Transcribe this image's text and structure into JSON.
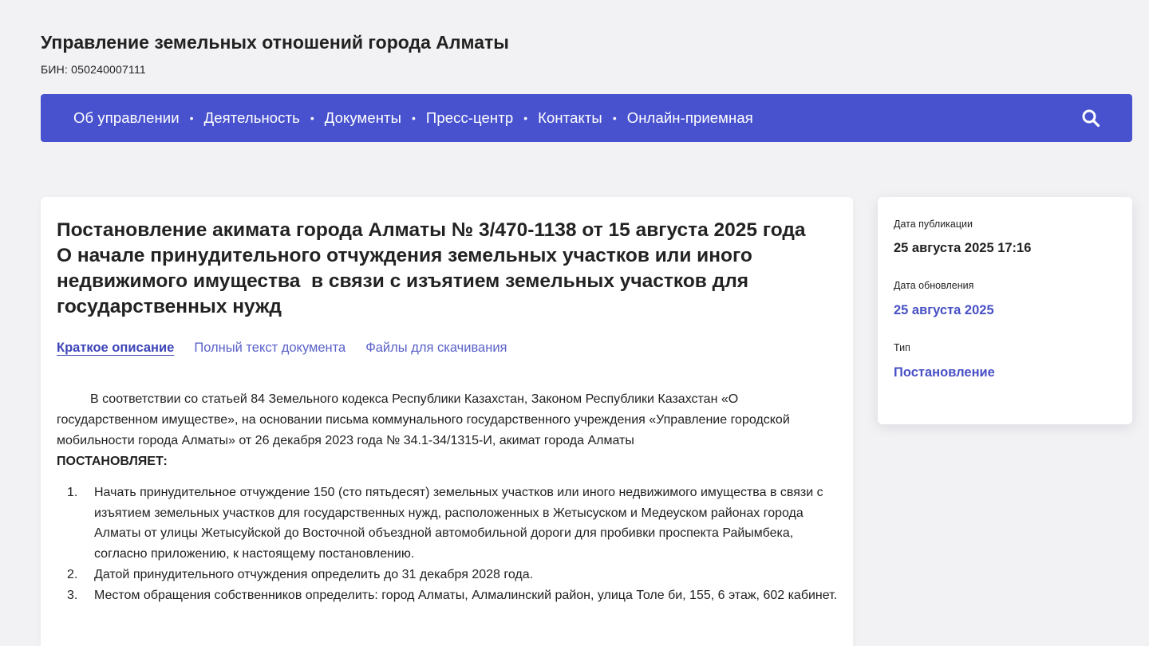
{
  "header": {
    "org_name": "Управление земельных отношений города Алматы",
    "bin": "БИН: 050240007111"
  },
  "nav": {
    "items": [
      {
        "label": "Об управлении"
      },
      {
        "label": "Деятельность"
      },
      {
        "label": "Документы"
      },
      {
        "label": "Пресс-центр"
      },
      {
        "label": "Контакты"
      },
      {
        "label": "Онлайн-приемная"
      }
    ],
    "separator": "•",
    "search_icon": "search-icon"
  },
  "document": {
    "title": "Постановление акимата города Алматы № 3/470-1138 от 15 августа 2025 года   О начале принудительного отчуждения земельных участков или иного недвижимого имущества  в связи с изъятием земельных участков для государственных нужд",
    "tabs": [
      {
        "label": "Краткое описание",
        "active": true
      },
      {
        "label": "Полный текст документа",
        "active": false
      },
      {
        "label": "Файлы для скачивания",
        "active": false
      }
    ],
    "intro": "В соответствии со статьей 84 Земельного кодекса Республики Казахстан, Законом Республики Казахстан «О государственном имуществе», на основании письма коммунального государственного учреждения «Управление городской мобильности города Алматы» от 26 декабря 2023 года № 34.1-34/1315-И, акимат города Алматы",
    "resolves": "ПОСТАНОВЛЯЕТ:",
    "points": [
      {
        "num": "1.",
        "text": "Начать принудительное отчуждение 150 (сто пятьдесят) земельных участков или иного недвижимого имущества в связи с изъятием земельных участков для государственных нужд, расположенных в Жетысуском и Медеуском районах города Алматы от улицы Жетысуйской до Восточной объездной автомобильной дороги для пробивки проспекта Райымбека, согласно приложению, к настоящему постановлению."
      },
      {
        "num": "2.",
        "text": "Датой принудительного отчуждения определить до 31 декабря 2028 года."
      },
      {
        "num": "3.",
        "text": "Местом обращения собственников определить: город Алматы, Алмалинский район, улица Толе би, 155, 6 этаж, 602 кабинет."
      }
    ]
  },
  "sidebar": {
    "published_label": "Дата публикации",
    "published_value": "25 августа 2025 17:16",
    "updated_label": "Дата обновления",
    "updated_value": "25 августа 2025",
    "type_label": "Тип",
    "type_value": "Постановление"
  },
  "colors": {
    "nav_bg": "#4852cf",
    "link": "#4750c4",
    "page_bg": "#f2f2f4"
  }
}
